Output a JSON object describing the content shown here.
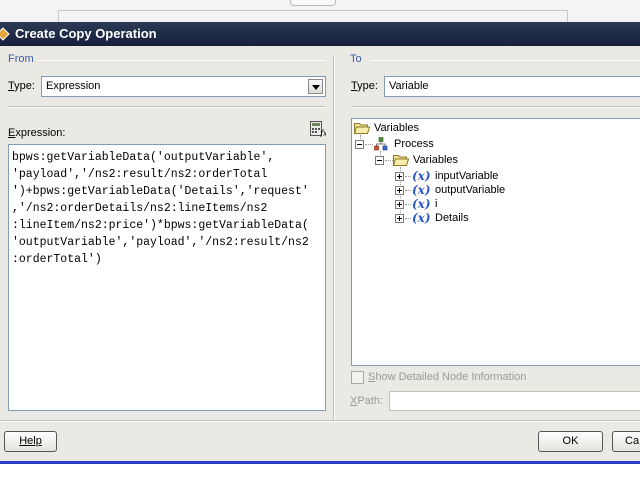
{
  "dialog": {
    "title": "Create Copy Operation",
    "ok_label": "OK",
    "cancel_label": "Ca",
    "help_label": "Help"
  },
  "from": {
    "section_label": "From",
    "type_label_mnemonic": "T",
    "type_label_rest": "ype:",
    "type_value": "Expression",
    "expression_label_mnemonic": "E",
    "expression_label_rest": "xpression:",
    "expression_lines": [
      "bpws:getVariableData('outputVariable',",
      "'payload','/ns2:result/ns2:orderTotal",
      "')+bpws:getVariableData('Details','request'",
      ",'/ns2:orderDetails/ns2:lineItems/ns2",
      ":lineItem/ns2:price')*bpws:getVariableData(",
      "'outputVariable','payload','/ns2:result/ns2",
      ":orderTotal')"
    ]
  },
  "to": {
    "section_label": "To",
    "type_label_mnemonic": "T",
    "type_label_rest": "ype:",
    "type_value": "Variable",
    "tree": {
      "root": "Variables",
      "process": "Process",
      "variables_folder": "Variables",
      "items": [
        "inputVariable",
        "outputVariable",
        "i",
        "Details"
      ]
    },
    "show_detail_label_mnemonic": "S",
    "show_detail_label_rest": "how Detailed Node Information",
    "xpath_label_mnemonic": "X",
    "xpath_label_rest": "Path:",
    "xpath_value": ""
  },
  "colors": {
    "title_bar": "#1e2a44",
    "dialog_bg": "#eae9e3",
    "section_label": "#3a5da8",
    "bottom_accent": "#2a3fbf"
  }
}
